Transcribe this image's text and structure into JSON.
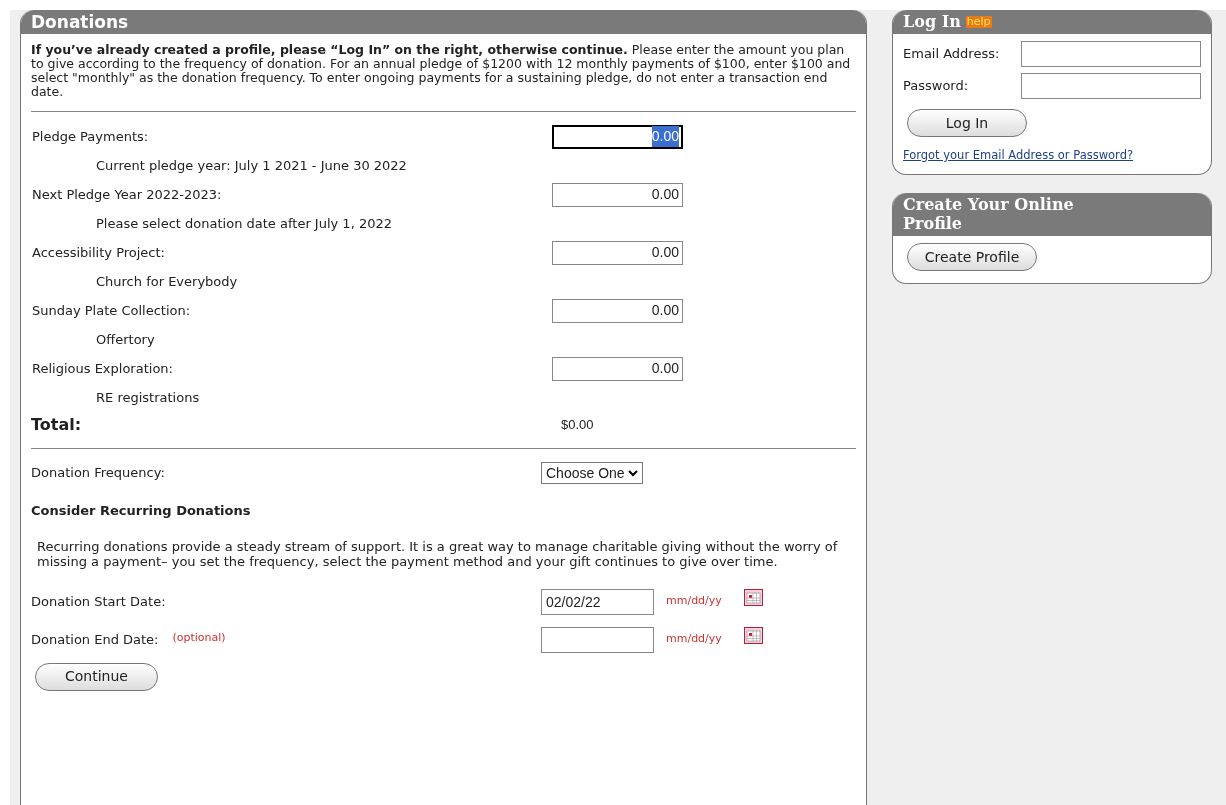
{
  "donations": {
    "title": "Donations",
    "intro": "**If you’ve already created a profile, please “Log In” on the right, otherwise continue.** Please enter the amount you plan to give according to the frequency of donation. For an annual pledge of $1200 with 12 monthly payments of $100, enter $100 and select \"monthly\" as the donation frequency. To enter ongoing payments for a sustaining pledge, do not enter a transaction end date.",
    "funds": [
      {
        "label": "Pledge Payments:",
        "value": "0.00",
        "focused": true,
        "note": "Current pledge year: July 1 2021 - June 30 2022"
      },
      {
        "label": "Next Pledge Year 2022-2023:",
        "value": "0.00",
        "focused": false,
        "note": "Please select donation date after July 1, 2022"
      },
      {
        "label": "Accessibility Project:",
        "value": "0.00",
        "focused": false,
        "note": "Church for Everybody"
      },
      {
        "label": "Sunday Plate Collection:",
        "value": "0.00",
        "focused": false,
        "note": "Offertory"
      },
      {
        "label": "Religious Exploration:",
        "value": "0.00",
        "focused": false,
        "note": "RE registrations"
      }
    ],
    "total": {
      "label": "Total:",
      "value": "$0.00"
    },
    "frequency": {
      "label": "Donation Frequency:",
      "value": "Choose One"
    },
    "recurring": {
      "heading": "Consider Recurring Donations",
      "text": "Recurring donations provide a steady stream of support. It is a great way to manage charitable giving without the worry of missing a payment– you set the frequency, select the payment method and your gift continues to give over time."
    },
    "dates": [
      {
        "label": "Donation Start Date:",
        "value": "02/02/22",
        "hint": "mm/dd/yy"
      },
      {
        "label": "Donation End Date:",
        "optional": "(optional)",
        "hint": "mm/dd/yy"
      }
    ],
    "continue_button": "Continue"
  },
  "login": {
    "title": "Log In",
    "help": "help",
    "fields": [
      {
        "label": "Email Address:"
      },
      {
        "label": "Password:"
      }
    ],
    "button": "Log In",
    "forgot_link": "Forgot your Email Address or Password?"
  },
  "profile": {
    "title": "Create Your Online Profile",
    "button": "Create Profile"
  }
}
